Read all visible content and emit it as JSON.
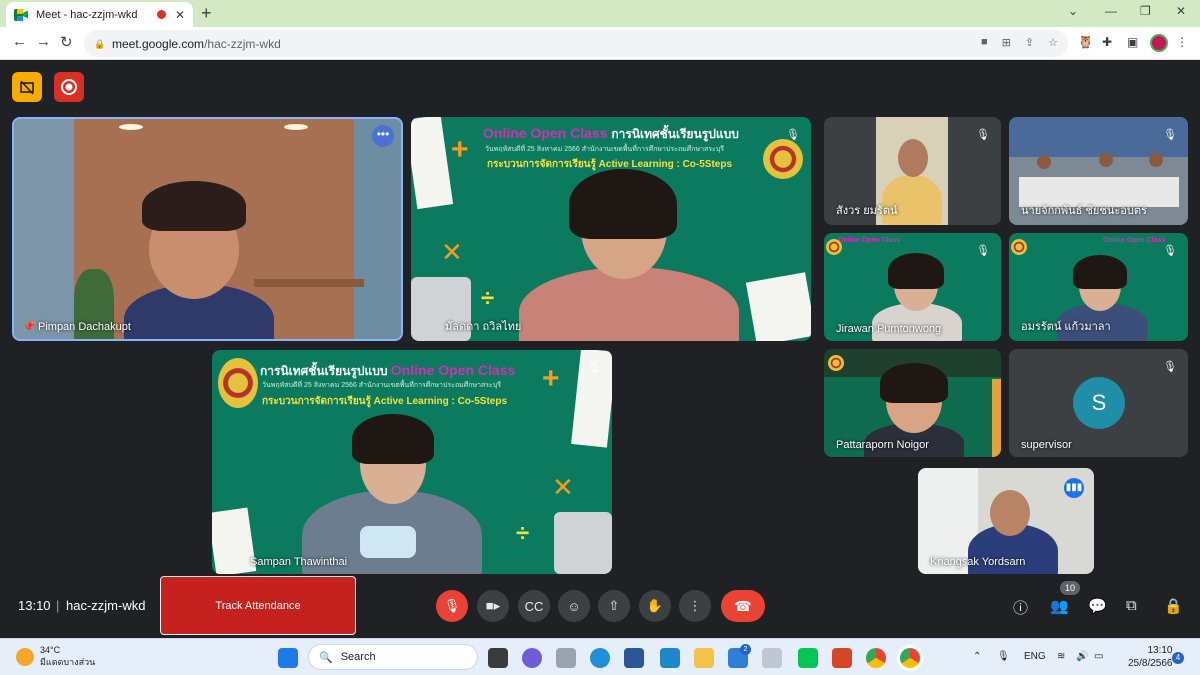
{
  "browser": {
    "tab_title": "Meet - hac-zzjm-wkd",
    "tab_close": "✕",
    "new_tab": "+",
    "url_host": "meet.google.com",
    "url_path": "/hac-zzjm-wkd"
  },
  "participants": [
    {
      "name": "Pimpan Dachakupt"
    },
    {
      "name": "มัลดดา ถวิลไทย"
    },
    {
      "name": "สังวร ยมรัตน์"
    },
    {
      "name": "นายจักกพันธ์ ชัยชนะอบตร"
    },
    {
      "name": "Jirawan Pumtonwong"
    },
    {
      "name": "อมรรัตน์ แก้วมาลา"
    },
    {
      "name": "Pattaraporn Noigor"
    },
    {
      "name": "supervisor",
      "avatar_letter": "S"
    },
    {
      "name": "Sampan Thawinthai"
    },
    {
      "name": "Kriangsak Yordsarn"
    }
  ],
  "slide": {
    "title_thai": "การนิเทศชั้นเรียนรูปแบบ",
    "title_en": "Online Open Class",
    "subtitle": "วันพฤหัสบดีที่ 25 สิงหาคม 2566 สำนักงานเขตพื้นที่การศึกษาประถมศึกษาสระบุรี",
    "process": "กระบวนการจัดการเรียนรู้ Active Learning : Co-5Steps"
  },
  "meeting": {
    "time": "13:10",
    "separator": "|",
    "code": "hac-zzjm-wkd",
    "track_attendance": "Track Attendance",
    "participant_count": "10"
  },
  "taskbar": {
    "temperature": "34°C",
    "weather_text": "มีแดดบางส่วน",
    "search_label": "Search",
    "language": "ENG",
    "clock_time": "13:10",
    "clock_date": "25/8/2566",
    "notification_count": "4",
    "mail_badge": "2"
  },
  "colors": {
    "stage_bg": "#202124",
    "accent_red": "#ea4335",
    "slide_green": "#0c7a5f",
    "slide_magenta": "#d12fb5",
    "slide_yellow": "#f5e23b"
  }
}
